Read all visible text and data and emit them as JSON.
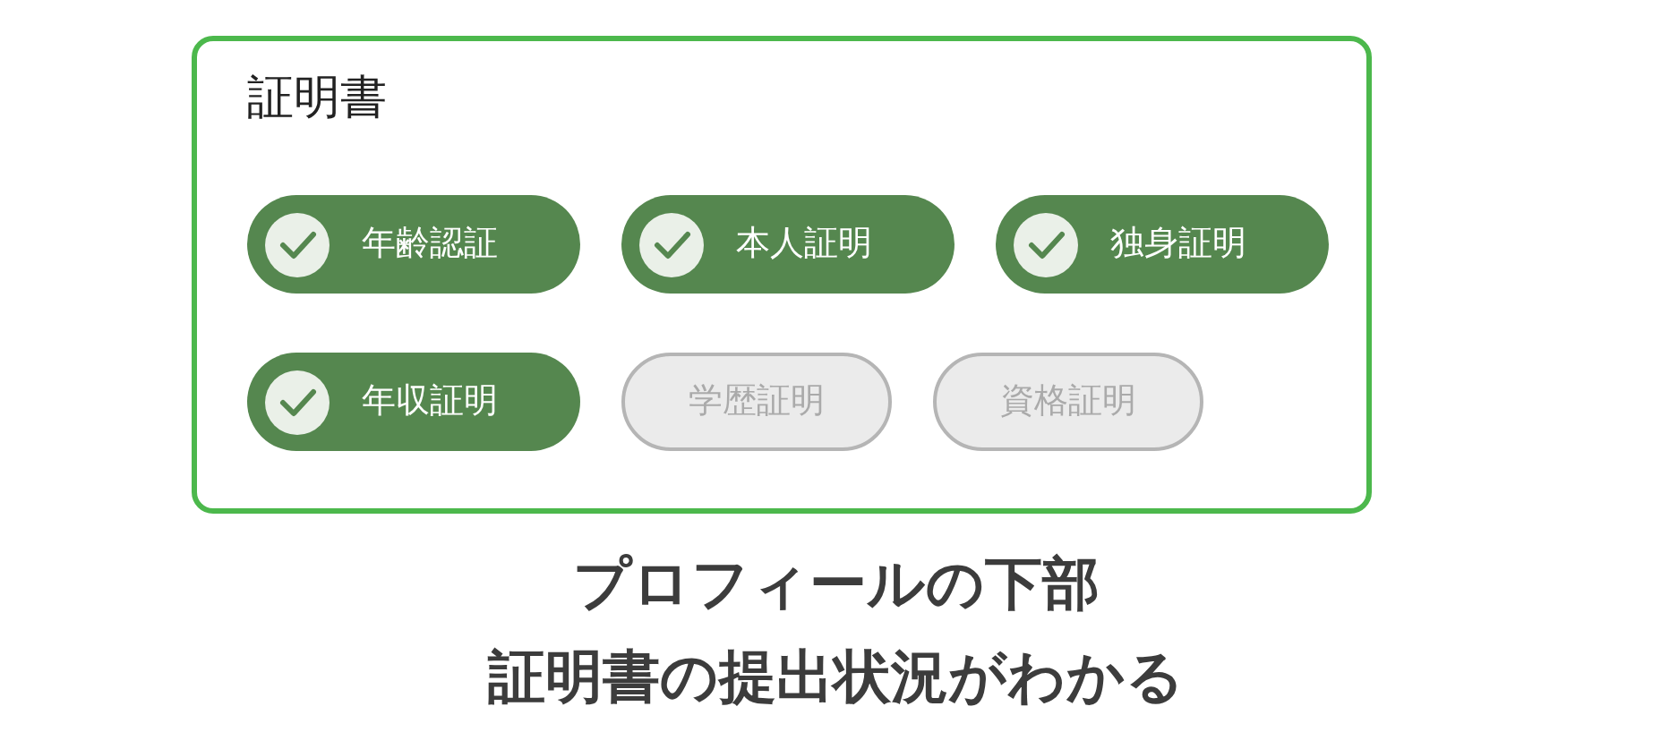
{
  "card": {
    "title": "証明書",
    "certificates": [
      {
        "label": "年齢認証",
        "submitted": true
      },
      {
        "label": "本人証明",
        "submitted": true
      },
      {
        "label": "独身証明",
        "submitted": true
      },
      {
        "label": "年収証明",
        "submitted": true
      },
      {
        "label": "学歴証明",
        "submitted": false
      },
      {
        "label": "資格証明",
        "submitted": false
      }
    ]
  },
  "caption": [
    "プロフィールの下部",
    "証明書の提出状況がわかる"
  ]
}
